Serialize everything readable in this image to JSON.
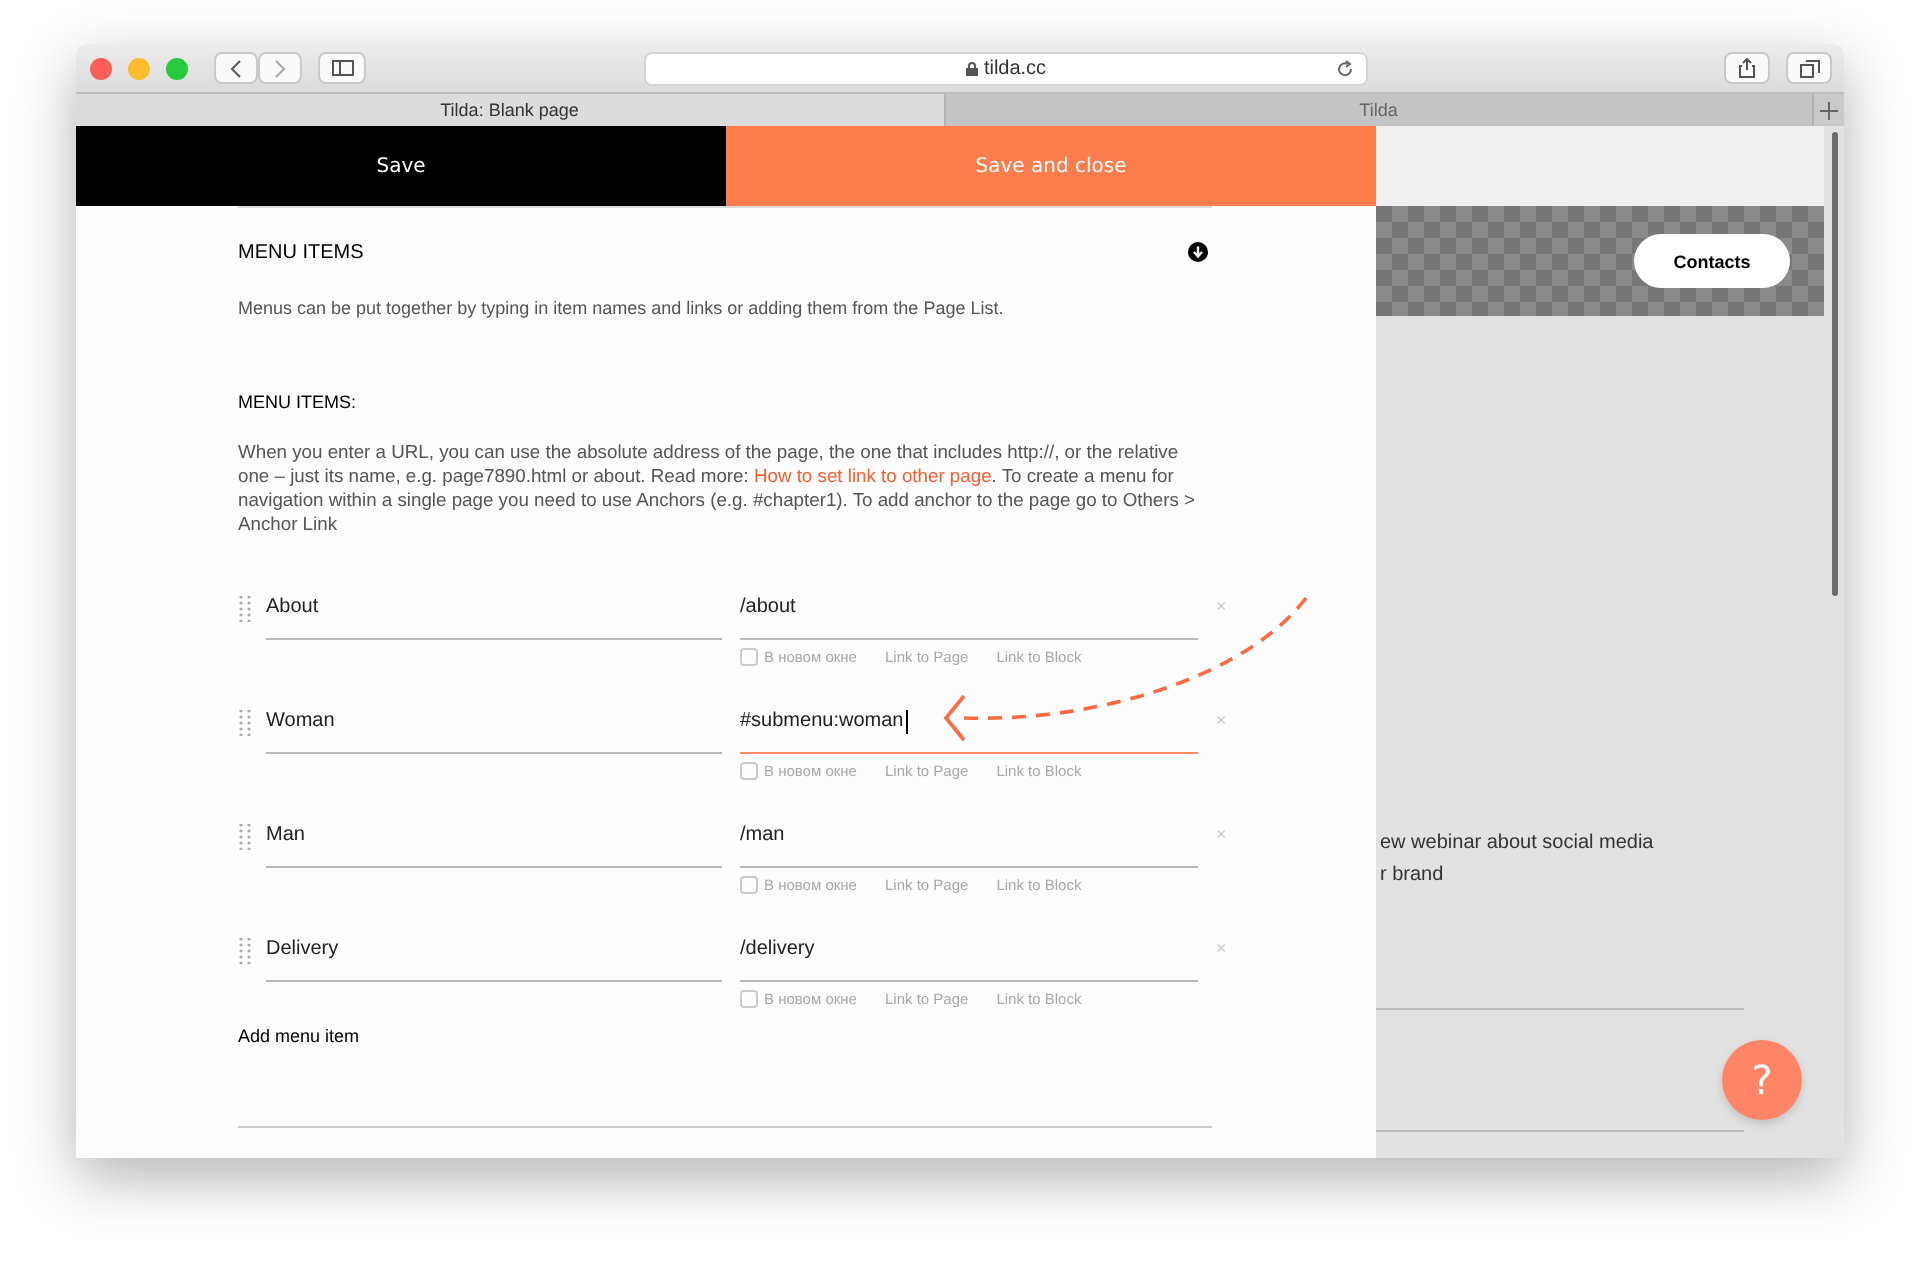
{
  "browser": {
    "url": "tilda.cc",
    "tabs": [
      {
        "label": "Tilda: Blank page",
        "selected": true
      },
      {
        "label": "Tilda",
        "selected": false
      }
    ]
  },
  "action_bar": {
    "save": "Save",
    "save_and_close": "Save and close"
  },
  "panel": {
    "title": "MENU ITEMS",
    "intro": "Menus can be put together by typing in item names and links or adding them from the Page List.",
    "subtitle": "MENU ITEMS:",
    "help_before": "When you enter a URL, you can use the absolute address of the page, the one that includes http://, or the relative one – just its name, e.g. page7890.html or about. Read more: ",
    "help_link": "How to set link to other page",
    "help_after": ". To create a menu for navigation within a single page you need to use Anchors (e.g. #chapter1). To add anchor to the page go to Others > Anchor Link",
    "items": [
      {
        "name": "About",
        "link": "/about",
        "focused": false,
        "new_window": false,
        "new_window_label": "В новом окне",
        "link_to_page": "Link to Page",
        "link_to_block": "Link to Block",
        "remove": "×"
      },
      {
        "name": "Woman",
        "link": "#submenu:woman",
        "focused": true,
        "new_window": false,
        "new_window_label": "В новом окне",
        "link_to_page": "Link to Page",
        "link_to_block": "Link to Block",
        "remove": "×"
      },
      {
        "name": "Man",
        "link": "/man",
        "focused": false,
        "new_window": false,
        "new_window_label": "В новом окне",
        "link_to_page": "Link to Page",
        "link_to_block": "Link to Block",
        "remove": "×"
      },
      {
        "name": "Delivery",
        "link": "/delivery",
        "focused": false,
        "new_window": false,
        "new_window_label": "В новом окне",
        "link_to_page": "Link to Page",
        "link_to_block": "Link to Block",
        "remove": "×"
      }
    ],
    "add_item": "Add menu item"
  },
  "page_behind": {
    "contacts_button": "Contacts",
    "webinar_lines": [
      "ew webinar about social media",
      "r brand"
    ],
    "help_button": "?"
  }
}
